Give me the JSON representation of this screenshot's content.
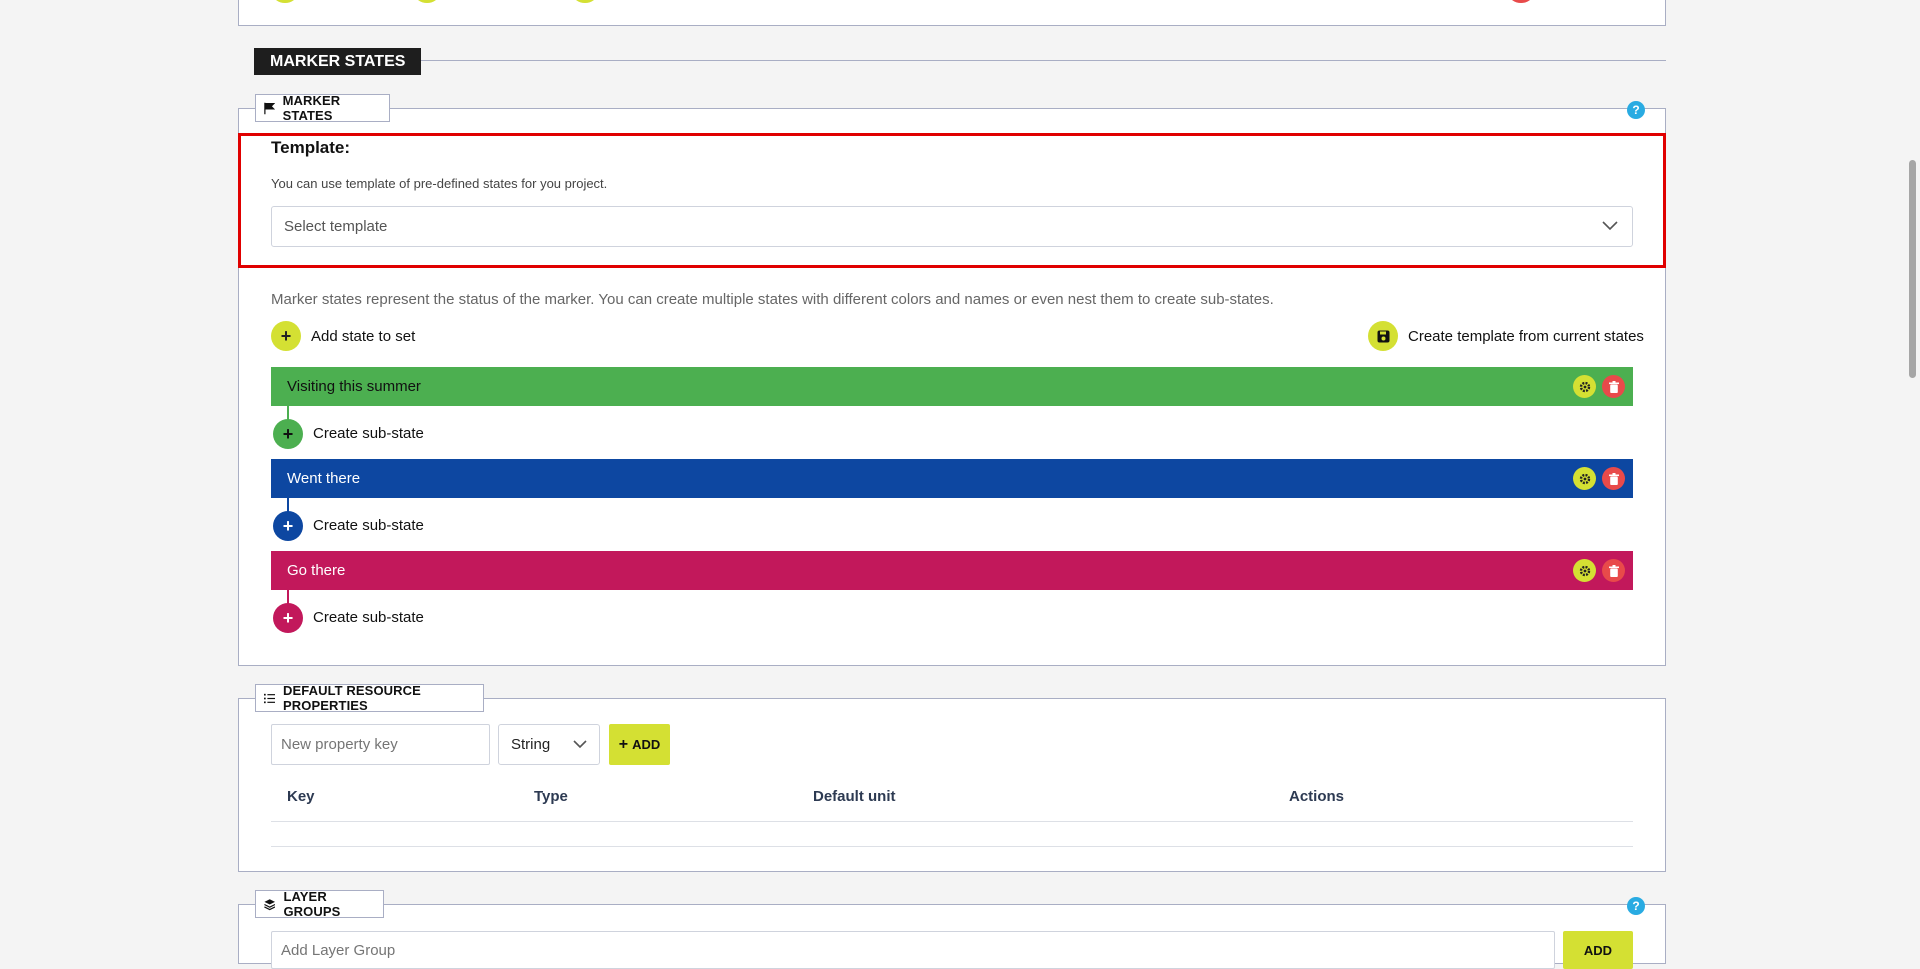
{
  "section": {
    "title": "MARKER STATES"
  },
  "marker_states_panel": {
    "label": "MARKER STATES",
    "help": "?",
    "template": {
      "title": "Template:",
      "hint": "You can use template of pre-defined states for you project.",
      "select_placeholder": "Select template"
    },
    "description": "Marker states represent the status of the marker. You can create multiple states with different colors and names or even nest them to create sub-states.",
    "add_state_label": "Add state to set",
    "create_template_label": "Create template from current states",
    "states": [
      {
        "name": "Visiting this summer",
        "color": "#4caf50",
        "sub_label": "Create sub-state"
      },
      {
        "name": "Went there",
        "color": "#0d47a1",
        "sub_label": "Create sub-state"
      },
      {
        "name": "Go there",
        "color": "#c2185b",
        "sub_label": "Create sub-state"
      }
    ]
  },
  "resource_panel": {
    "label": "DEFAULT RESOURCE PROPERTIES",
    "key_placeholder": "New property key",
    "type_value": "String",
    "add_label": "ADD",
    "columns": [
      "Key",
      "Type",
      "Default unit",
      "Actions"
    ]
  },
  "layer_panel": {
    "label": "LAYER GROUPS",
    "help": "?",
    "input_placeholder": "Add Layer Group",
    "add_label": "ADD"
  },
  "colors": {
    "accent": "#d4e033",
    "danger": "#e84a4a",
    "highlight": "#e00000"
  }
}
